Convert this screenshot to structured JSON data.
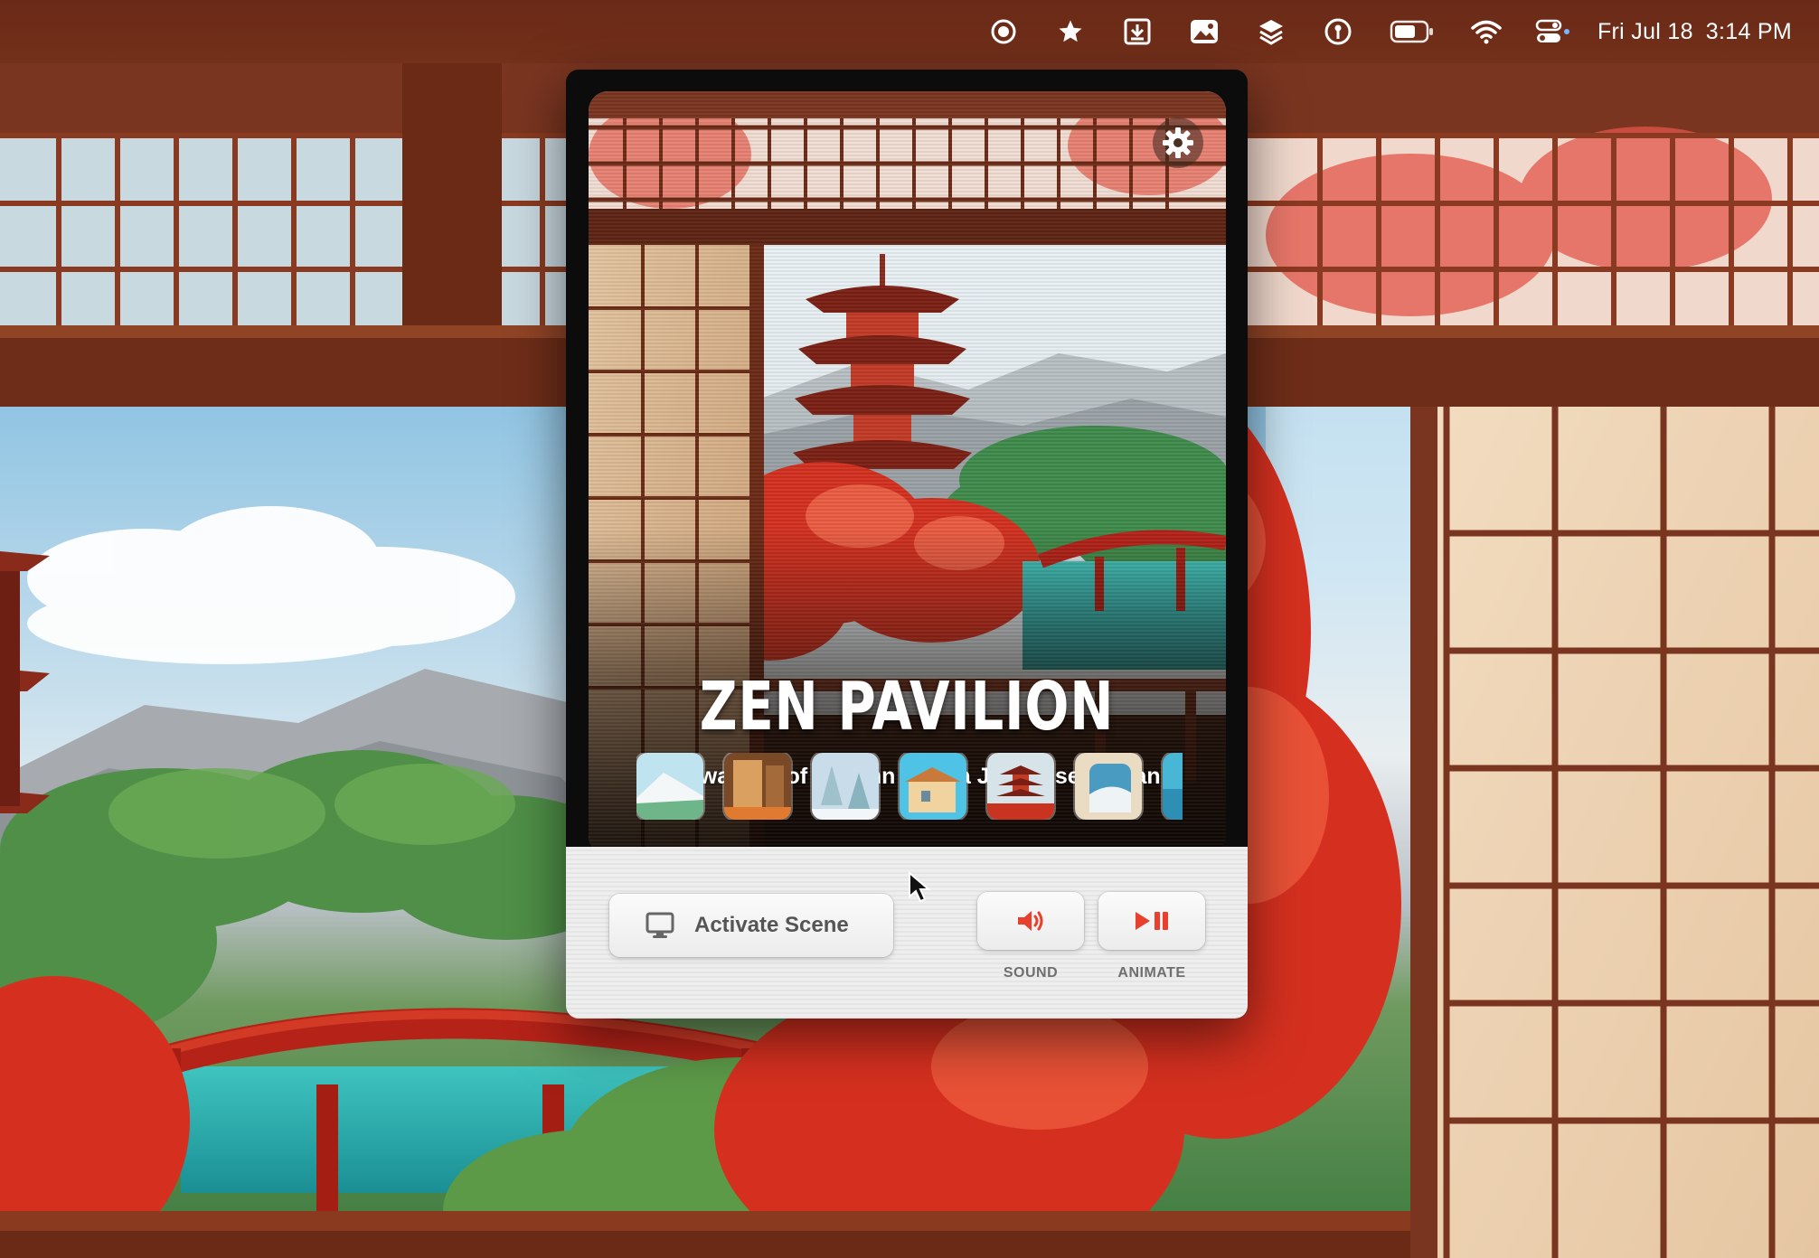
{
  "menubar": {
    "icons": [
      "record-icon",
      "star-icon",
      "download-box-icon",
      "photo-icon",
      "layers-icon",
      "password-key-icon",
      "battery-icon",
      "wifi-icon",
      "control-center-icon"
    ],
    "date": "Fri Jul 18",
    "time": "3:14 PM"
  },
  "popover": {
    "settings_icon": "gear-icon",
    "scene": {
      "title": "ZEN PAVILION",
      "subtitle": "The warmth of autumn from a Japanese ryokan"
    },
    "thumbnails": [
      {
        "name": "mountain-fuji",
        "selected": false
      },
      {
        "name": "wooden-room",
        "selected": false
      },
      {
        "name": "snowy-pines",
        "selected": false
      },
      {
        "name": "seaside-villa",
        "selected": false
      },
      {
        "name": "pagoda",
        "selected": true
      },
      {
        "name": "window-sea",
        "selected": false
      },
      {
        "name": "ocean-partial",
        "selected": false
      }
    ],
    "controls": {
      "activate_label": "Activate Scene",
      "sound_label": "SOUND",
      "animate_label": "ANIMATE"
    }
  },
  "colors": {
    "menubar_bg": "#6a2a17",
    "accent_red": "#e8402c",
    "popover_bg": "#0c0c0c",
    "control_bg": "#eeeeee"
  }
}
